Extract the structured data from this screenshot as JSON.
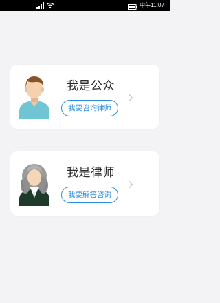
{
  "status_bar": {
    "time": "中午11:07",
    "icons": [
      "signal-icon",
      "wifi-icon",
      "battery-icon"
    ]
  },
  "cards": [
    {
      "title": "我是公众",
      "button_label": "我要咨询律师",
      "avatar": "man-avatar-icon"
    },
    {
      "title": "我是律师",
      "button_label": "我要解答咨询",
      "avatar": "judge-wig-avatar-icon"
    }
  ],
  "colors": {
    "accent": "#2d8ee0",
    "background": "#f3f3f5",
    "card": "#ffffff",
    "status_bar": "#000000"
  }
}
